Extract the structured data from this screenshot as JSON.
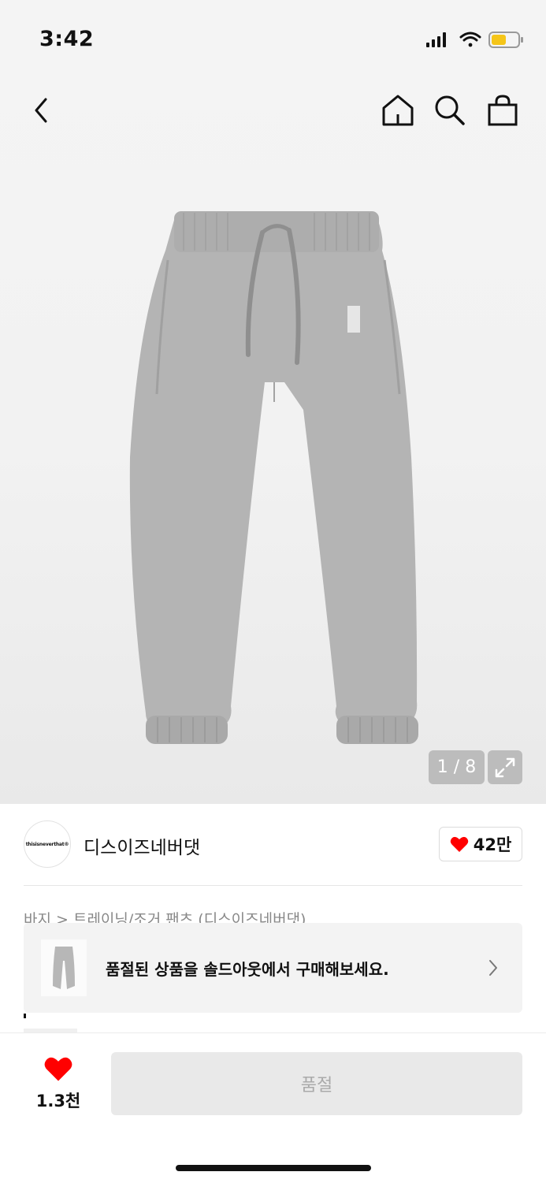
{
  "status_bar": {
    "time": "3:42"
  },
  "gallery": {
    "counter": "1 / 8"
  },
  "brand": {
    "logo_text": "thisisneverthat®",
    "name": "디스이즈네버댓",
    "likes": "42만"
  },
  "breadcrumb": "바지 > 트레이닝/조거 팬츠 (디스이즈네버댓)",
  "soldout_banner": {
    "text": "품절된 상품을 솔드아웃에서 구매해보세요."
  },
  "bottom_bar": {
    "wish_count": "1.3천",
    "buy_label": "품절"
  },
  "colors": {
    "heart": "#ff0000",
    "button_bg": "#e9e9e9",
    "button_text": "#aaaaaa"
  }
}
